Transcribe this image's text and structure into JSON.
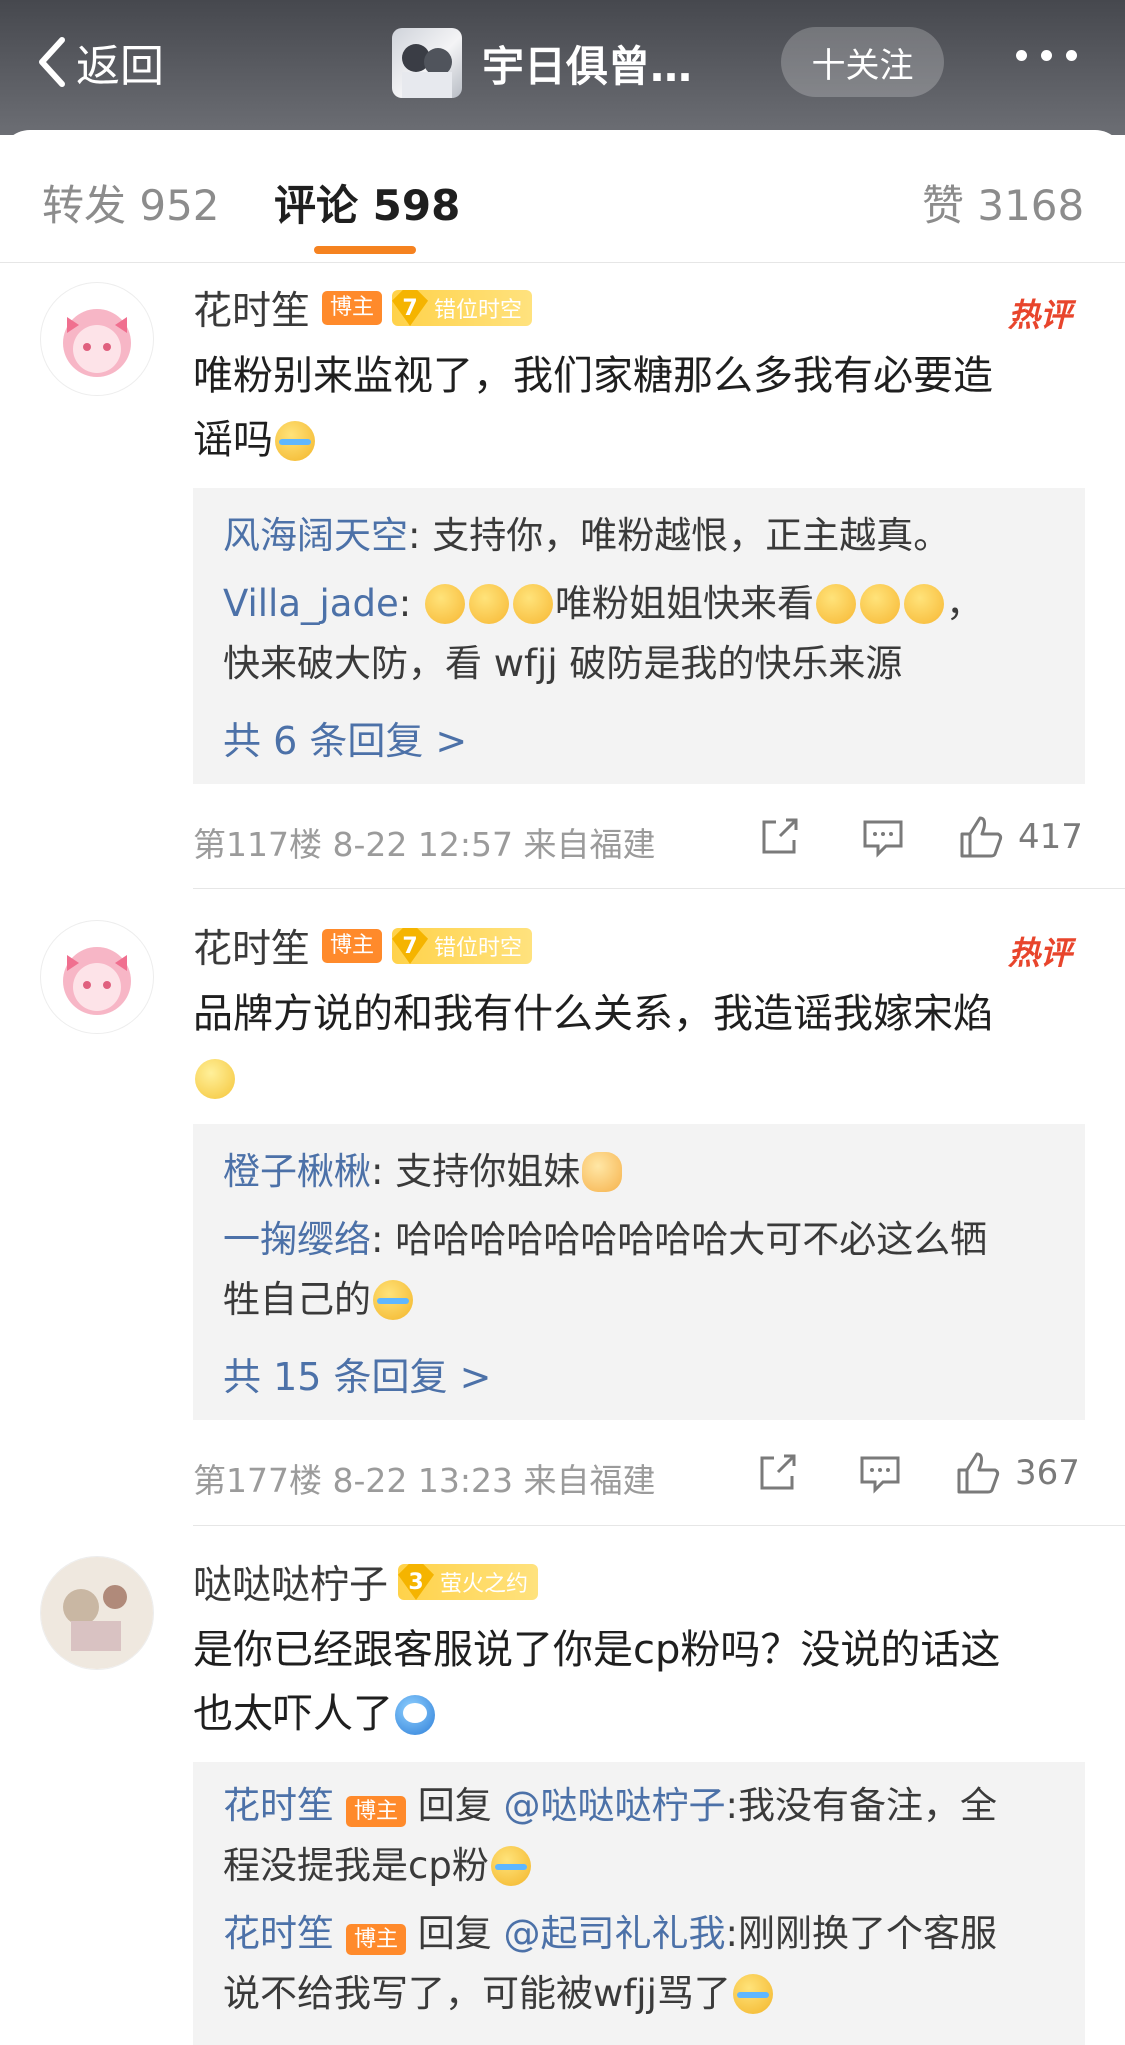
{
  "header": {
    "back_label": "返回",
    "title": "宇日俱曾…",
    "follow_label": "十关注"
  },
  "tabs": [
    {
      "label": "转发 952"
    },
    {
      "label": "评论 598"
    },
    {
      "label": "赞 3168"
    }
  ],
  "comments": [
    {
      "name": "花时笙",
      "badge": "博主",
      "fan_level": "7",
      "fan_name": "错位时空",
      "hot": "热评",
      "text_line1": "唯粉别来监视了，我们家糖那么多我有必要造",
      "text_line2": "谣吗",
      "replies": [
        {
          "name": "风海阔天空",
          "text": ": 支持你，唯粉越恨，正主越真。"
        },
        {
          "name": "Villa_jade",
          "text_a": ": ",
          "text_b": "唯粉姐姐快来看",
          "text_c": "，",
          "text_line2": "快来破大防，看 wfjj 破防是我的快乐来源"
        }
      ],
      "more_replies": "共 6 条回复 >",
      "meta": "第117楼  8-22 12:57  来自福建",
      "likes": "417"
    },
    {
      "name": "花时笙",
      "badge": "博主",
      "fan_level": "7",
      "fan_name": "错位时空",
      "hot": "热评",
      "text_line1": "品牌方说的和我有什么关系，我造谣我嫁宋焰",
      "replies": [
        {
          "name": "橙子楸楸",
          "text": ": 支持你姐妹"
        },
        {
          "name": "一掬缨络",
          "text": ": 哈哈哈哈哈哈哈哈哈大可不必这么牺",
          "text_line2": "牲自己的"
        }
      ],
      "more_replies": "共 15 条回复 >",
      "meta": "第177楼  8-22 13:23  来自福建",
      "likes": "367"
    },
    {
      "name": "哒哒哒柠子",
      "fan_level": "3",
      "fan_name": "萤火之约",
      "text_line1": "是你已经跟客服说了你是cp粉吗？没说的话这",
      "text_line2": "也太吓人了",
      "replies": [
        {
          "name": "花时笙",
          "badge": "博主",
          "reply_word": " 回复 ",
          "mention": "@哒哒哒柠子",
          "text": ":我没有备注，全",
          "text_line2": "程没提我是cp粉"
        },
        {
          "name": "花时笙",
          "badge": "博主",
          "reply_word": " 回复 ",
          "mention": "@起司礼礼我",
          "text": ":刚刚换了个客服",
          "text_line2": "说不给我写了，可能被wfjj骂了"
        }
      ]
    }
  ]
}
